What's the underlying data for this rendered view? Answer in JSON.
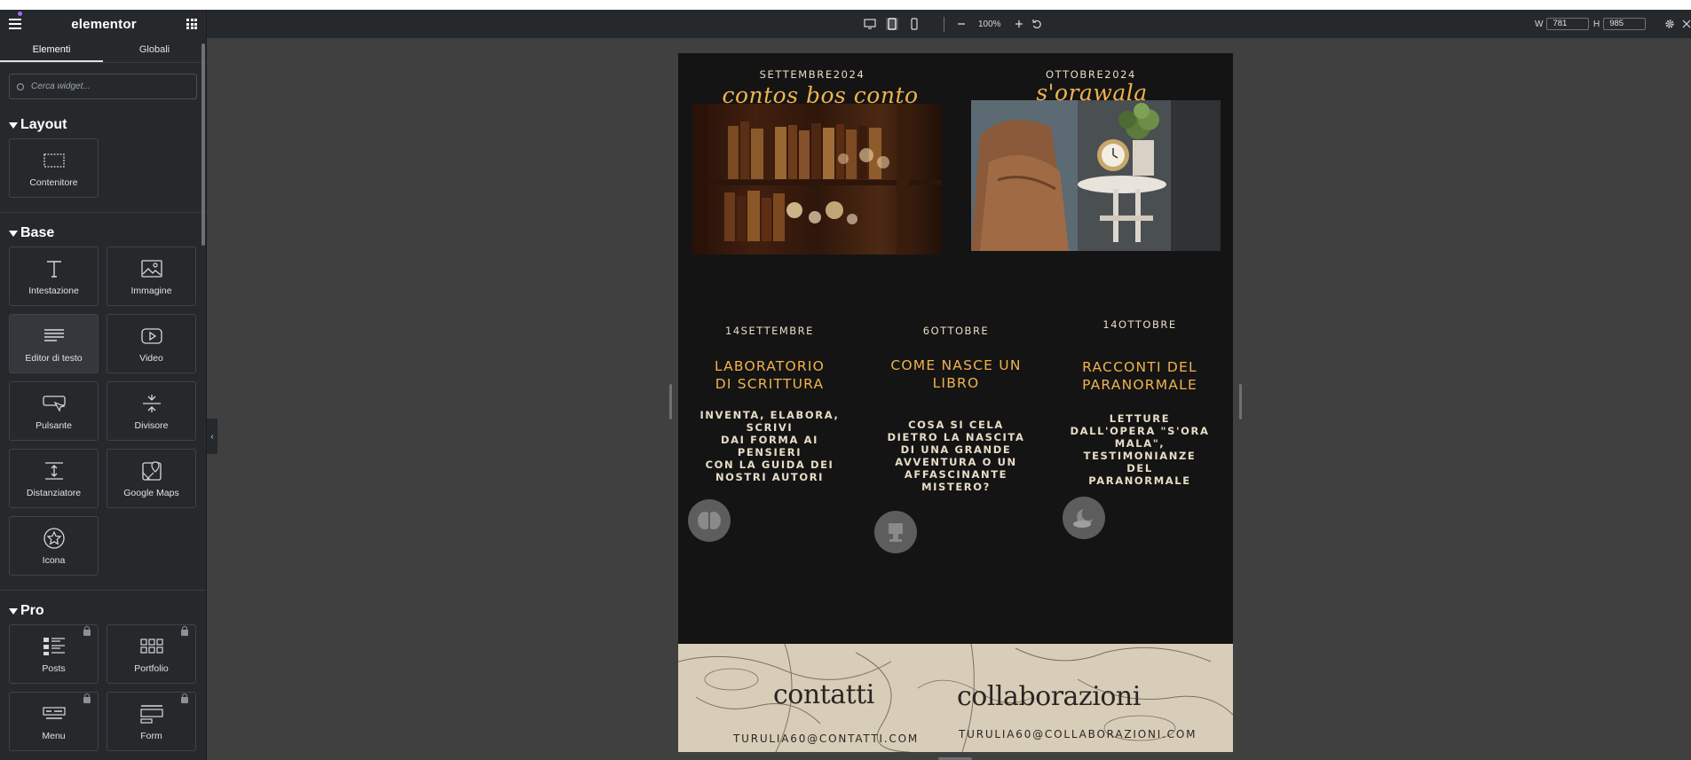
{
  "sidebar": {
    "logo": "elementor",
    "tabs": [
      "Elementi",
      "Globali"
    ],
    "search_placeholder": "Cerca widget...",
    "sections": {
      "layout": {
        "title": "Layout",
        "widgets": [
          "Contenitore"
        ]
      },
      "base": {
        "title": "Base",
        "widgets": [
          "Intestazione",
          "Immagine",
          "Editor di testo",
          "Video",
          "Pulsante",
          "Divisore",
          "Distanziatore",
          "Google Maps",
          "Icona"
        ]
      },
      "pro": {
        "title": "Pro",
        "widgets": [
          "Posts",
          "Portfolio",
          "Menu",
          "Form"
        ]
      }
    }
  },
  "toolbar": {
    "zoom": "100%",
    "width_label": "W",
    "width_value": "781",
    "height_label": "H",
    "height_value": "985"
  },
  "page": {
    "featured": [
      {
        "month": "SETTEMBRE2024",
        "title": "contos bos conto"
      },
      {
        "month": "OTTOBRE2024",
        "title": "s'orawala"
      }
    ],
    "events": [
      {
        "date": "14SETTEMBRE",
        "title_lines": [
          "LABORATORIO",
          "DI SCRITTURA"
        ],
        "desc_lines": [
          "INVENTA, ELABORA,",
          "SCRIVI",
          "DAI FORMA AI",
          "PENSIERI",
          "CON LA GUIDA DEI",
          "NOSTRI AUTORI"
        ]
      },
      {
        "date": "6OTTOBRE",
        "title_lines": [
          "COME NASCE UN",
          "LIBRO"
        ],
        "desc_lines": [
          "COSA SI CELA",
          "DIETRO LA NASCITA",
          "DI UNA GRANDE",
          "AVVENTURA O UN",
          "AFFASCINANTE",
          "MISTERO?"
        ]
      },
      {
        "date": "14OTTOBRE",
        "title_lines": [
          "RACCONTI DEL",
          "PARANORMALE"
        ],
        "desc_lines": [
          "LETTURE",
          "DALL'OPERA \"S'ORA",
          "MALA\",",
          "TESTIMONIANZE DEL",
          "PARANORMALE"
        ]
      }
    ],
    "contacts": {
      "contacts_word": "contatti",
      "collab_word": "collaborazioni",
      "contacts_email": "TURULIA60@CONTATTI.COM",
      "collab_email": "TURULIA60@COLLABORAZIONI.COM"
    }
  }
}
